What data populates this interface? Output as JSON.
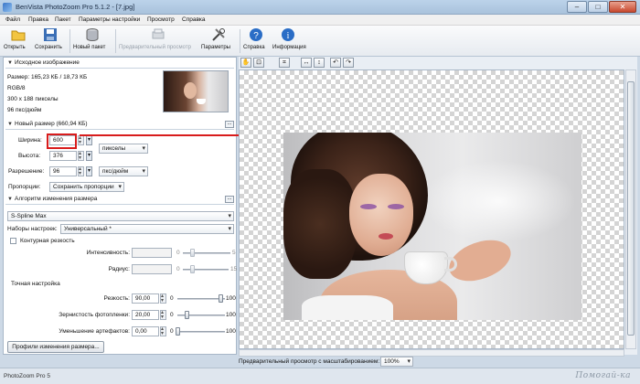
{
  "window": {
    "title": "BenVista PhotoZoom Pro 5.1.2 - [7.jpg]",
    "minimize": "–",
    "maximize": "□",
    "close": "✕"
  },
  "menu": [
    "Файл",
    "Правка",
    "Пакет",
    "Параметры настройки",
    "Просмотр",
    "Справка"
  ],
  "toolbar": {
    "open": "Открыть",
    "save": "Сохранить",
    "new_batch": "Новый пакет",
    "preview": "Предварительный просмотр",
    "settings": "Параметры",
    "help": "Справка",
    "info": "Информация"
  },
  "source": {
    "header": "Исходное изображение",
    "size": "Размер: 165,23 КБ / 18,73 КБ",
    "mode": "RGB/8",
    "dimensions": "300 x 188 пикселы",
    "resolution": "96 пкс/дюйм"
  },
  "new_size": {
    "header": "Новый размер (660,94 КБ)",
    "width_label": "Ширина:",
    "width_value": "600",
    "height_label": "Высота:",
    "height_value": "376",
    "resolution_label": "Разрешение:",
    "resolution_value": "96",
    "units": "пикселы",
    "res_units": "пкс/дюйм",
    "proportions_label": "Пропорции:",
    "proportions_value": "Сохранить пропорции"
  },
  "algorithm": {
    "header": "Алгоритм изменения размера",
    "method": "S-Spline Max",
    "presets_label": "Наборы настроек:",
    "presets_value": "Универсальный *",
    "unsharp_label": "Контурная резкость",
    "intensity_label": "Интенсивность:",
    "radius_label": "Радиус:",
    "intensity_max": "5",
    "radius_max": "15"
  },
  "fine_tune": {
    "header": "Точная настройка",
    "sharpness_label": "Резкость:",
    "sharpness_value": "90,00",
    "sharpness_level": 0.9,
    "film_grain_label": "Зернистость фотопленки:",
    "film_grain_value": "20,00",
    "film_grain_level": 0.2,
    "artifact_label": "Уменьшение артефактов:",
    "artifact_value": "0,00",
    "artifact_level": 0.0,
    "min": "0",
    "max": "100"
  },
  "profiles_button": "Профили изменения размера...",
  "preview": {
    "label": "Предварительный просмотр с масштабированием:",
    "zoom": "100%"
  },
  "status": {
    "text": "PhotoZoom Pro 5",
    "watermark": "Помогай-ка"
  }
}
